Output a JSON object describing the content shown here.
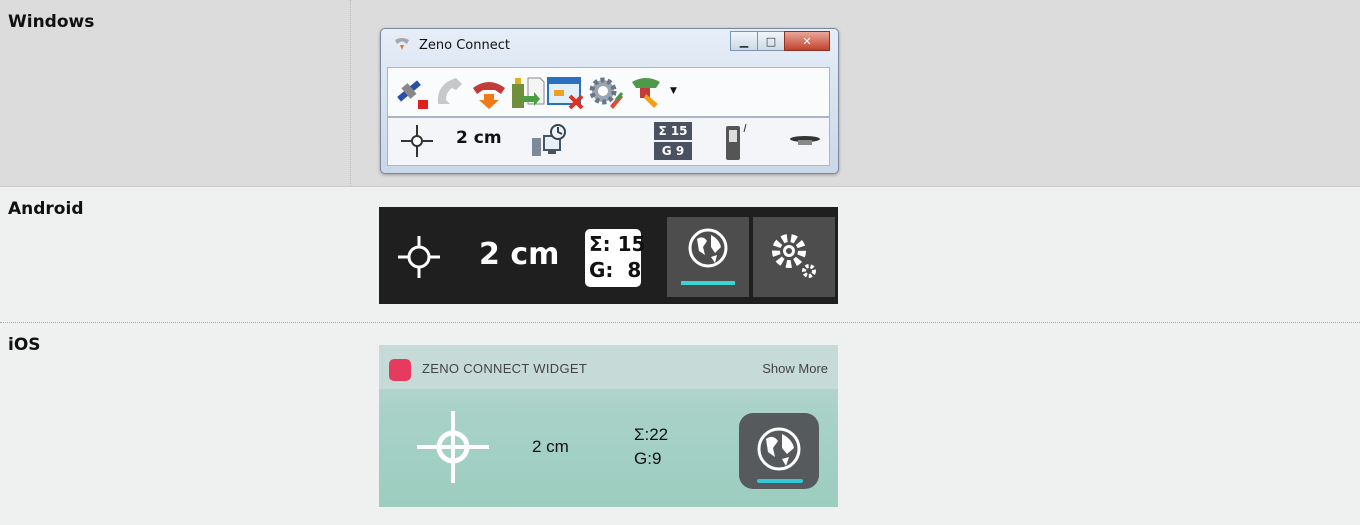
{
  "rows": {
    "windows": "Windows",
    "android": "Android",
    "ios": "iOS"
  },
  "windows": {
    "title": "Zeno Connect",
    "distance": "2 cm",
    "sat_sum": "Σ 15",
    "sat_g": "G 9"
  },
  "android": {
    "distance": "2 cm",
    "sat_sum": "Σ: 15",
    "sat_g": "G:  8"
  },
  "ios": {
    "widget_title": "ZENO CONNECT WIDGET",
    "show_more": "Show More",
    "distance": "2 cm",
    "sat_sum": "Σ:22",
    "sat_g": "G:9"
  },
  "colors": {
    "android_accent": "#3bd3d3",
    "ios_accent": "#33c9d9",
    "ios_app_icon": "#e63a5e"
  }
}
